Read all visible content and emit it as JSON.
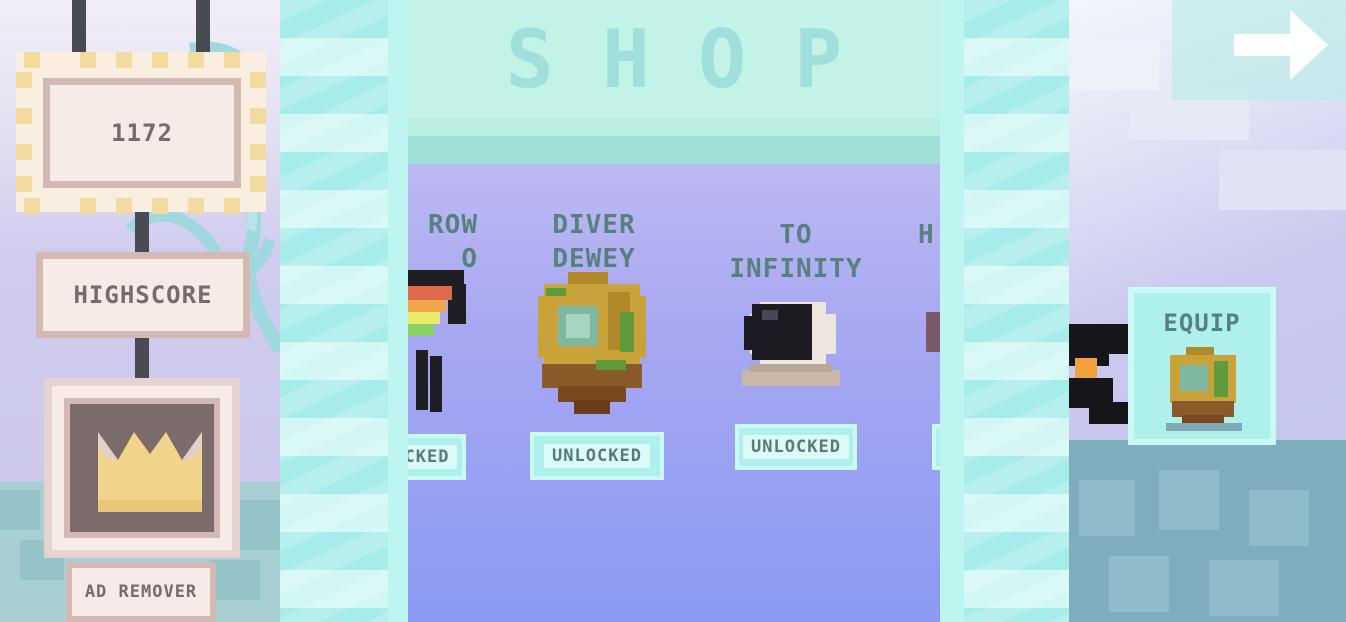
{
  "left": {
    "score": "1172",
    "highscore_label": "HIGHSCORE",
    "ad_remover_label": "AD REMOVER"
  },
  "shop": {
    "title": "SHOP",
    "items": [
      {
        "name": "ROW\nO",
        "status": "CKED"
      },
      {
        "name": "DIVER\nDEWEY",
        "status": "UNLOCKED"
      },
      {
        "name": "TO\nINFINITY",
        "status": "UNLOCKED"
      },
      {
        "name": "H",
        "status": ""
      }
    ]
  },
  "right": {
    "equip_label": "EQUIP"
  },
  "icons": {
    "crown": "crown-icon",
    "arrow": "arrow-right-icon",
    "diver": "diver-helmet-icon",
    "astronaut": "astronaut-helmet-icon",
    "bird": "black-bird-icon"
  },
  "colors": {
    "shop_bg": "#a8a8f2",
    "accent_teal": "#aef0ec",
    "sign_cream": "#f6ebe6",
    "sign_border": "#d4b8b4",
    "text_dark": "#57817f"
  }
}
